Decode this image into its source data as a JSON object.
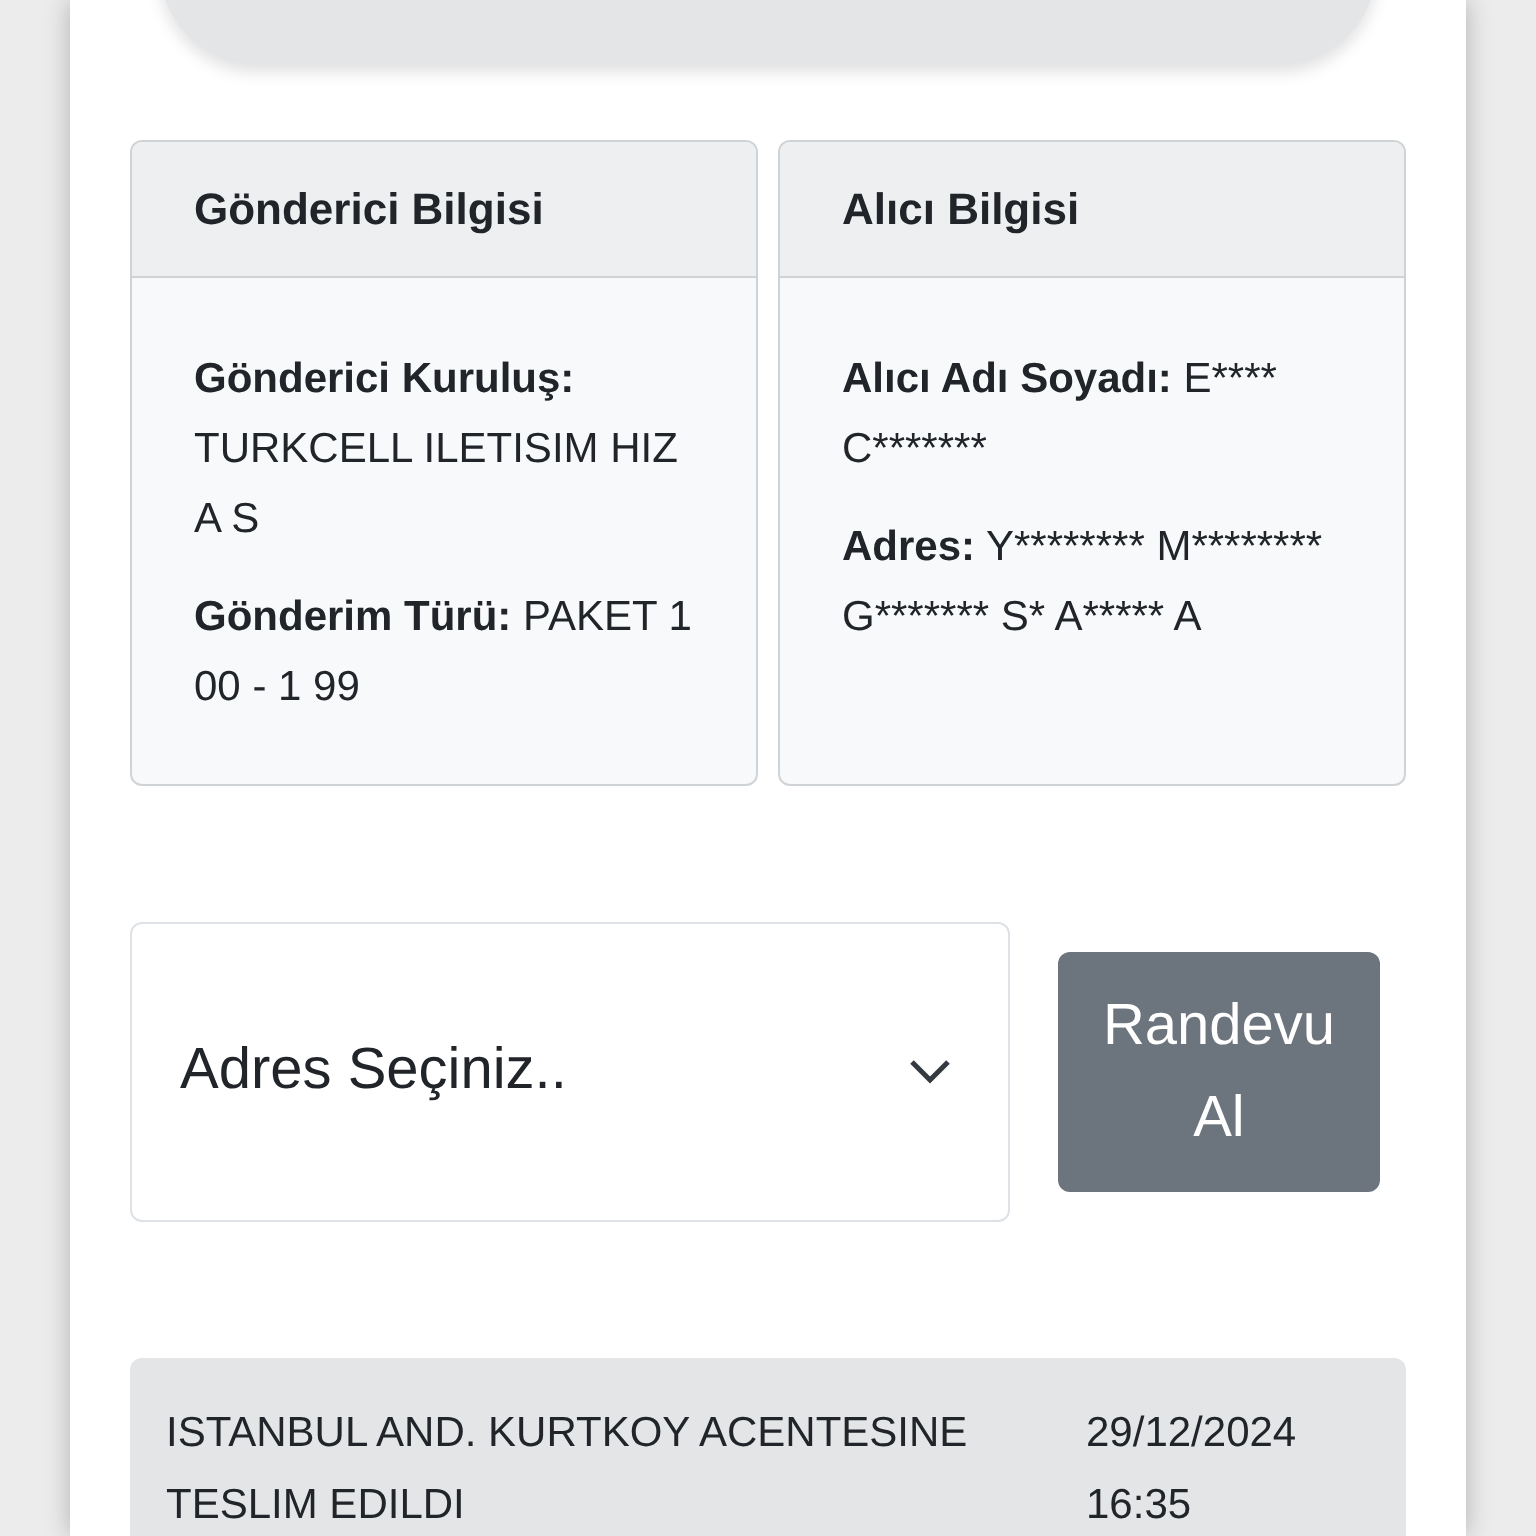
{
  "sender": {
    "title": "Gönderici Bilgisi",
    "fields": [
      {
        "label": "Gönderici Kuruluş:",
        "value": "TURKCELL ILETISIM HIZ A S"
      },
      {
        "label": "Gönderim Türü:",
        "value": "PAKET 1 00 - 1 99"
      }
    ]
  },
  "recipient": {
    "title": "Alıcı Bilgisi",
    "fields": [
      {
        "label": "Alıcı Adı Soyadı:",
        "value": "E**** C*******"
      },
      {
        "label": "Adres:",
        "value": "Y******** M******** G******* S* A***** A"
      }
    ]
  },
  "address_select": {
    "placeholder": "Adres Seçiniz.."
  },
  "appointment_button": {
    "label": "Randevu Al"
  },
  "events": [
    {
      "description": "ISTANBUL AND. KURTKOY ACENTESINE TESLIM EDILDI",
      "date": "29/12/2024",
      "time": "16:35"
    }
  ]
}
